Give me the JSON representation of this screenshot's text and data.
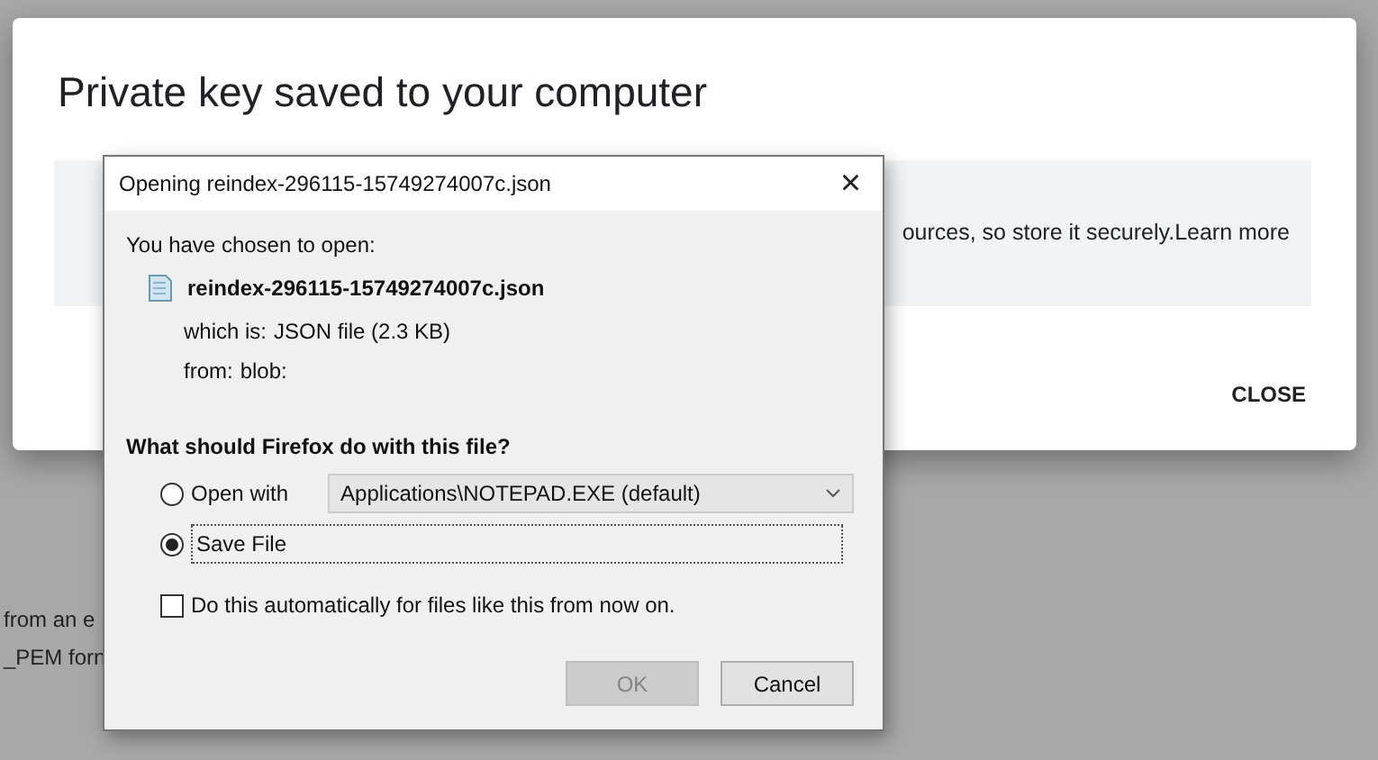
{
  "background_text": [
    "from an e",
    "_PEM forn"
  ],
  "dialog": {
    "title": "Private key saved to your computer",
    "notice": {
      "text": "ources, so store it securely.",
      "link": "Learn more"
    },
    "close_button": "CLOSE"
  },
  "download_dialog": {
    "title": "Opening reindex-296115-15749274007c.json",
    "close_glyph": "×",
    "intro": "You have chosen to open:",
    "file_name": "reindex-296115-15749274007c.json",
    "details": [
      {
        "label": "which is:",
        "value": "JSON file (2.3 KB)"
      },
      {
        "label": "from:",
        "value": "blob:"
      }
    ],
    "question": "What should Firefox do with this file?",
    "options": [
      {
        "label": "Open with",
        "selected": false,
        "app": "Applications\\NOTEPAD.EXE (default)"
      },
      {
        "label": "Save File",
        "selected": true
      }
    ],
    "auto_checkbox": {
      "label": "Do this automatically for files like this from now on.",
      "checked": false
    },
    "buttons": [
      {
        "label": "OK",
        "disabled": true
      },
      {
        "label": "Cancel",
        "disabled": false
      }
    ]
  }
}
